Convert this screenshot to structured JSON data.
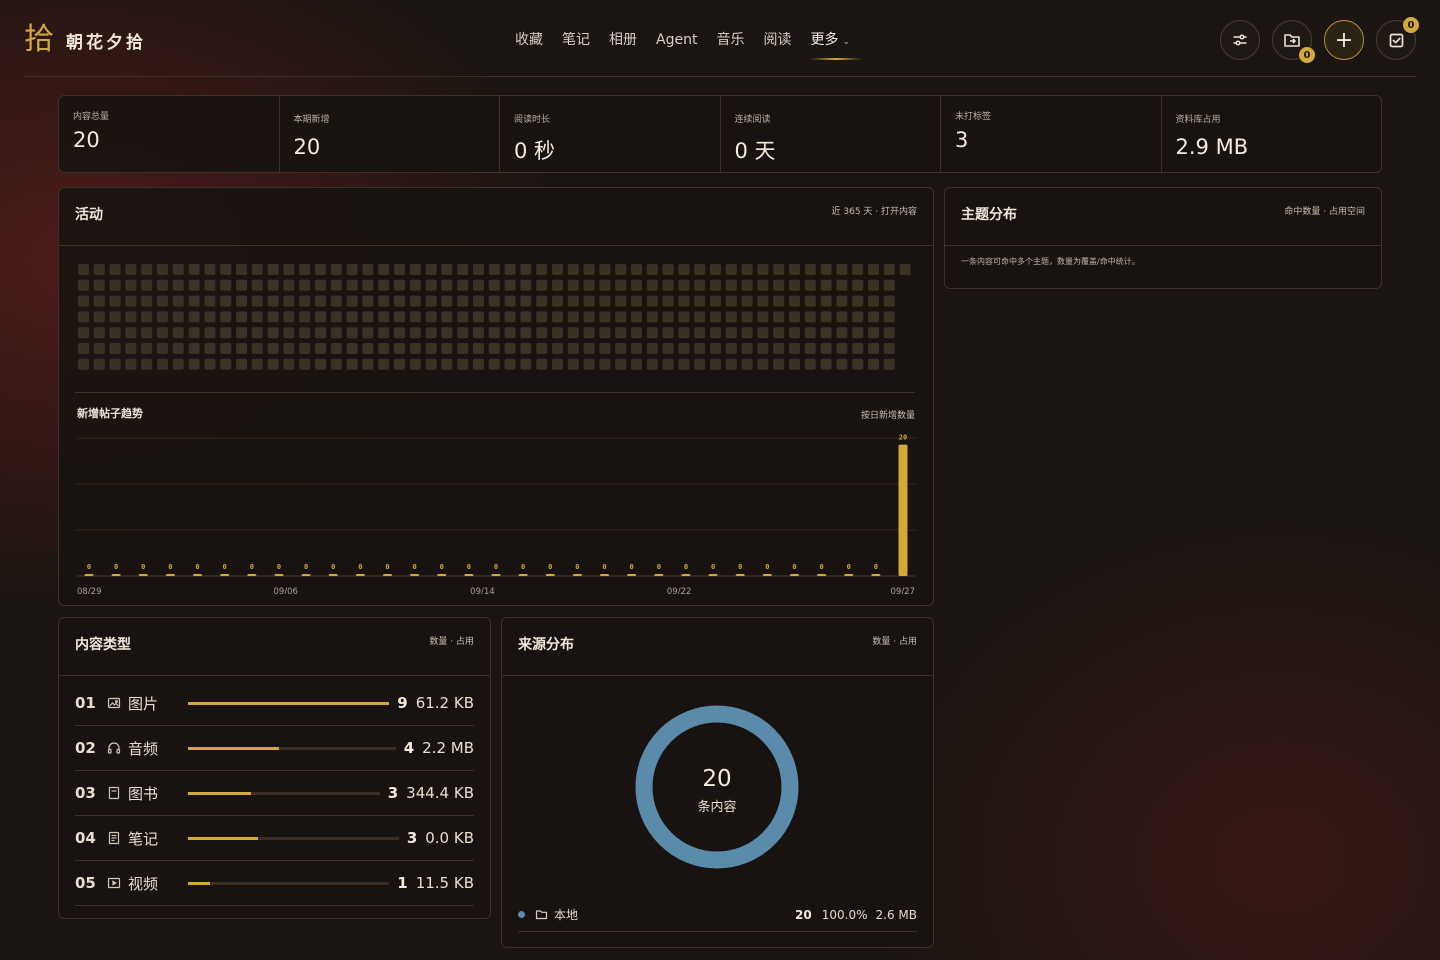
{
  "app": {
    "logo_mark": "拾",
    "name": "朝花夕拾"
  },
  "nav": {
    "items": [
      "收藏",
      "笔记",
      "相册",
      "Agent",
      "音乐",
      "阅读"
    ],
    "more_label": "更多",
    "active": "更多"
  },
  "tools": {
    "import_badge": "0",
    "tasks_badge": "0"
  },
  "stats": [
    {
      "label": "内容总量",
      "value": "20"
    },
    {
      "label": "本期新增",
      "value": "20"
    },
    {
      "label": "阅读时长",
      "value": "0 秒"
    },
    {
      "label": "连续阅读",
      "value": "0 天"
    },
    {
      "label": "未打标签",
      "value": "3"
    },
    {
      "label": "资料库占用",
      "value": "2.9 MB"
    }
  ],
  "activity": {
    "title": "活动",
    "meta": "近 365 天 · 打开内容",
    "trend_title": "新增帖子趋势",
    "trend_meta": "按日新增数量"
  },
  "chart_data": {
    "type": "bar",
    "title": "新增帖子趋势",
    "x_tick_labels": [
      "08/29",
      "09/06",
      "09/14",
      "09/22",
      "09/27"
    ],
    "values": [
      0,
      0,
      0,
      0,
      0,
      0,
      0,
      0,
      0,
      0,
      0,
      0,
      0,
      0,
      0,
      0,
      0,
      0,
      0,
      0,
      0,
      0,
      0,
      0,
      0,
      0,
      0,
      0,
      0,
      0,
      20
    ],
    "ylim": [
      0,
      21
    ],
    "grid": true,
    "legend": "none"
  },
  "topics": {
    "title": "主题分布",
    "meta": "命中数量 · 占用空间",
    "note": "一条内容可命中多个主题，数量为覆盖/命中统计。"
  },
  "types": {
    "title": "内容类型",
    "meta": "数量 · 占用",
    "rows": [
      {
        "idx": "01",
        "icon": "image-icon",
        "name": "图片",
        "count": "9",
        "size": "61.2 KB",
        "fraction": 1.0
      },
      {
        "idx": "02",
        "icon": "headphones-icon",
        "name": "音频",
        "count": "4",
        "size": "2.2 MB",
        "fraction": 0.44
      },
      {
        "idx": "03",
        "icon": "book-icon",
        "name": "图书",
        "count": "3",
        "size": "344.4 KB",
        "fraction": 0.33
      },
      {
        "idx": "04",
        "icon": "note-icon",
        "name": "笔记",
        "count": "3",
        "size": "0.0 KB",
        "fraction": 0.33
      },
      {
        "idx": "05",
        "icon": "video-icon",
        "name": "视频",
        "count": "1",
        "size": "11.5 KB",
        "fraction": 0.11
      }
    ]
  },
  "sources": {
    "title": "来源分布",
    "meta": "数量 · 占用",
    "total": "20",
    "total_label": "条内容",
    "rows": [
      {
        "icon": "folder-icon",
        "name": "本地",
        "count": "20",
        "percent": "100.0%",
        "size": "2.6 MB",
        "color": "#5b8bab",
        "fraction": 1.0
      }
    ]
  },
  "colors": {
    "accent": "#d2a93a",
    "heat_cell": "#3a3223",
    "source_blue": "#5b8bab"
  }
}
